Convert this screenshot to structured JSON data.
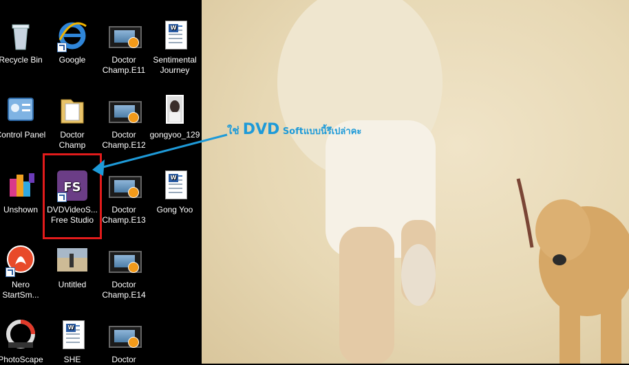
{
  "desktop": {
    "icons": [
      {
        "label": "Recycle Bin"
      },
      {
        "label": "Google"
      },
      {
        "label": "Doctor Champ.E11"
      },
      {
        "label": "Sentimental Journey"
      },
      {
        "label": "Control Panel"
      },
      {
        "label": "Doctor Champ"
      },
      {
        "label": "Doctor Champ.E12"
      },
      {
        "label": "gongyoo_129"
      },
      {
        "label": "Unshown"
      },
      {
        "label": "DVDVideoS... Free Studio"
      },
      {
        "label": "Doctor Champ.E13"
      },
      {
        "label": "Gong Yoo"
      },
      {
        "label": "Nero StartSm..."
      },
      {
        "label": "Untitled"
      },
      {
        "label": "Doctor Champ.E14"
      },
      {
        "label": "PhotoScape"
      },
      {
        "label": "SHE"
      },
      {
        "label": "Doctor"
      }
    ]
  },
  "annotation": {
    "prefix": "ใช่ ",
    "strong": "DVD",
    "suffix": " Softแบบนี้รึเปล่าคะ",
    "color": "#1e9ad8"
  },
  "highlight_color": "#e21b1b",
  "icon_names": {
    "recycle": "recycle-bin-icon",
    "ie": "internet-explorer-icon",
    "video": "video-file-icon",
    "doc": "word-document-icon",
    "control": "control-panel-icon",
    "folder": "folder-icon",
    "image": "image-file-icon",
    "dvd": "dvd-studio-icon",
    "nero": "nero-icon",
    "photo": "photoscape-icon"
  }
}
